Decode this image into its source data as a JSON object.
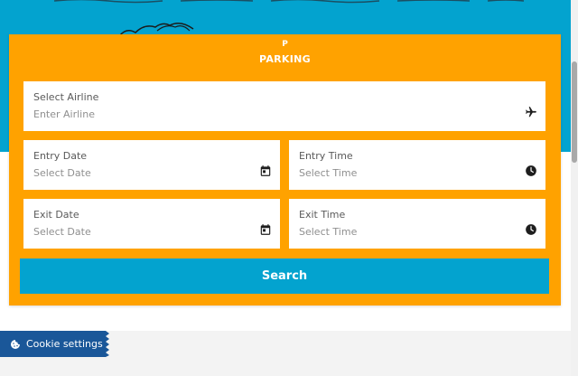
{
  "card": {
    "icon_letter": "P",
    "title": "PARKING"
  },
  "form": {
    "airline": {
      "label": "Select Airline",
      "placeholder": "Enter Airline",
      "icon": "airplane-icon"
    },
    "entry_date": {
      "label": "Entry Date",
      "placeholder": "Select Date",
      "icon": "calendar-icon"
    },
    "entry_time": {
      "label": "Entry Time",
      "placeholder": "Select Time",
      "icon": "clock-icon"
    },
    "exit_date": {
      "label": "Exit Date",
      "placeholder": "Select Date",
      "icon": "calendar-icon"
    },
    "exit_time": {
      "label": "Exit Time",
      "placeholder": "Select Time",
      "icon": "clock-icon"
    },
    "search_label": "Search"
  },
  "cookie_banner": {
    "label": "Cookie settings",
    "icon": "cookie-icon"
  },
  "colors": {
    "hero_bg": "#03a3cf",
    "card_bg": "#ffa200",
    "button_bg": "#03a3cf",
    "cookie_bg": "#1a5799",
    "icon": "#1e1e1e"
  }
}
